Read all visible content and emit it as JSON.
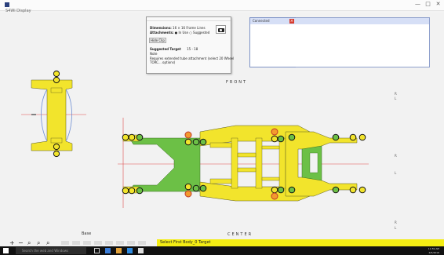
{
  "window": {
    "title": "S4Wi Display",
    "controls": [
      "—",
      "□",
      "✕"
    ]
  },
  "dialog": {
    "dimensions_label": "Dimensions:",
    "dimensions_value": "16 × 16",
    "format_label": "Frame Lines",
    "attachments_label": "Attachments:",
    "option_a": "In Use",
    "option_b": "Suggested",
    "button_label": "Hide Clip",
    "target_label": "Suggested Target",
    "target_value": "15 - 18",
    "note_label": "Note",
    "note_line1": "Requires extended tube attachment (select 20 Wheel",
    "note_line2": "TORC... options)",
    "camera_icon": "camera-icon"
  },
  "panel": {
    "title": "Connected"
  },
  "labels": {
    "front": "FRONT",
    "center": "CENTER",
    "base": "Base"
  },
  "side_labels": [
    "R",
    "L",
    "R",
    "L",
    "R",
    "L"
  ],
  "toolbar": {
    "zoom_in": "+",
    "zoom_out": "−",
    "status": "Select First Body_0 Target"
  },
  "taskbar": {
    "search_placeholder": "Search the web and Windows",
    "time": "11:59 AM",
    "date": "2/5/2016"
  },
  "colors": {
    "frame_yellow": "#f2e42c",
    "frame_green": "#6cc046",
    "marker_orange": "#f39a2e",
    "axis_red": "#e04a4a",
    "status_yellow": "#f4ed14"
  }
}
